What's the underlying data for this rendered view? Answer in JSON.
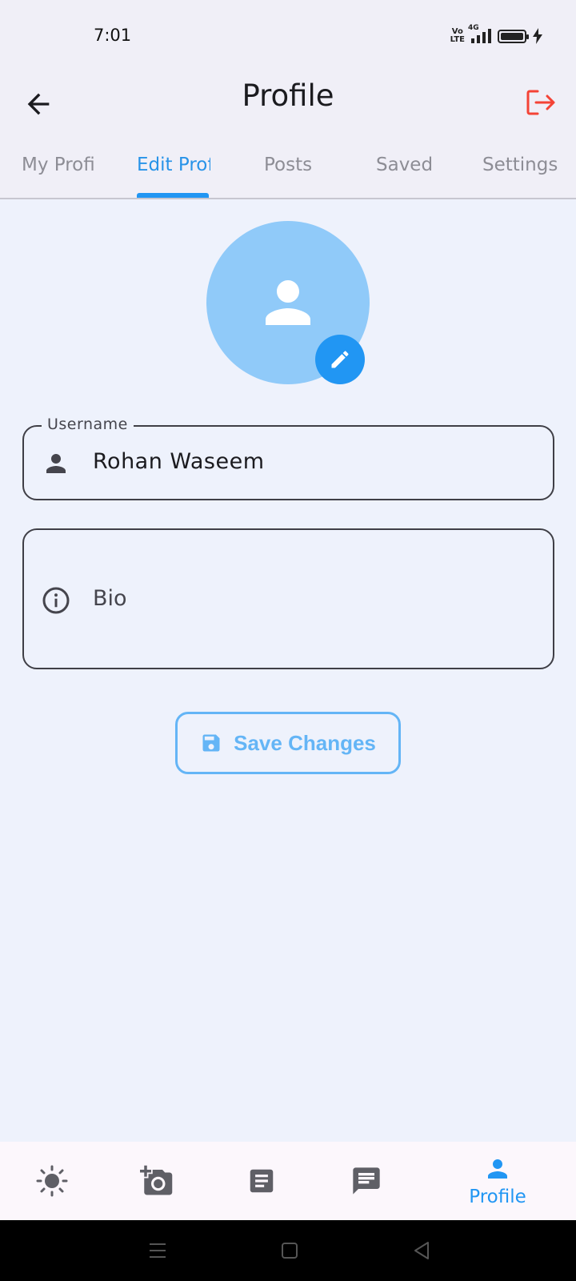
{
  "status_bar": {
    "time": "7:01",
    "network": "4G",
    "volte": [
      "Vo",
      "LTE"
    ]
  },
  "header": {
    "title": "Profile",
    "back_icon": "arrow-left-icon",
    "logout_icon": "logout-icon",
    "logout_color": "#f44336"
  },
  "tabs": [
    {
      "label": "My Profile",
      "active": false
    },
    {
      "label": "Edit Profile",
      "active": true
    },
    {
      "label": "Posts",
      "active": false
    },
    {
      "label": "Saved",
      "active": false
    },
    {
      "label": "Settings",
      "active": false
    }
  ],
  "form": {
    "username_label": "Username",
    "username_value": "Rohan Waseem",
    "bio_placeholder": "Bio"
  },
  "save_button": {
    "label": "Save Changes",
    "icon": "save-icon"
  },
  "bottom_nav": [
    {
      "icon": "sun-icon",
      "label": "",
      "active": false
    },
    {
      "icon": "add-photo-icon",
      "label": "",
      "active": false
    },
    {
      "icon": "article-icon",
      "label": "",
      "active": false
    },
    {
      "icon": "chat-icon",
      "label": "",
      "active": false
    },
    {
      "icon": "person-icon",
      "label": "Profile",
      "active": true
    }
  ],
  "colors": {
    "accent": "#2196f3",
    "accent_light": "#64b5f6",
    "avatar_bg": "#90caf9",
    "background": "#eef2fc"
  }
}
